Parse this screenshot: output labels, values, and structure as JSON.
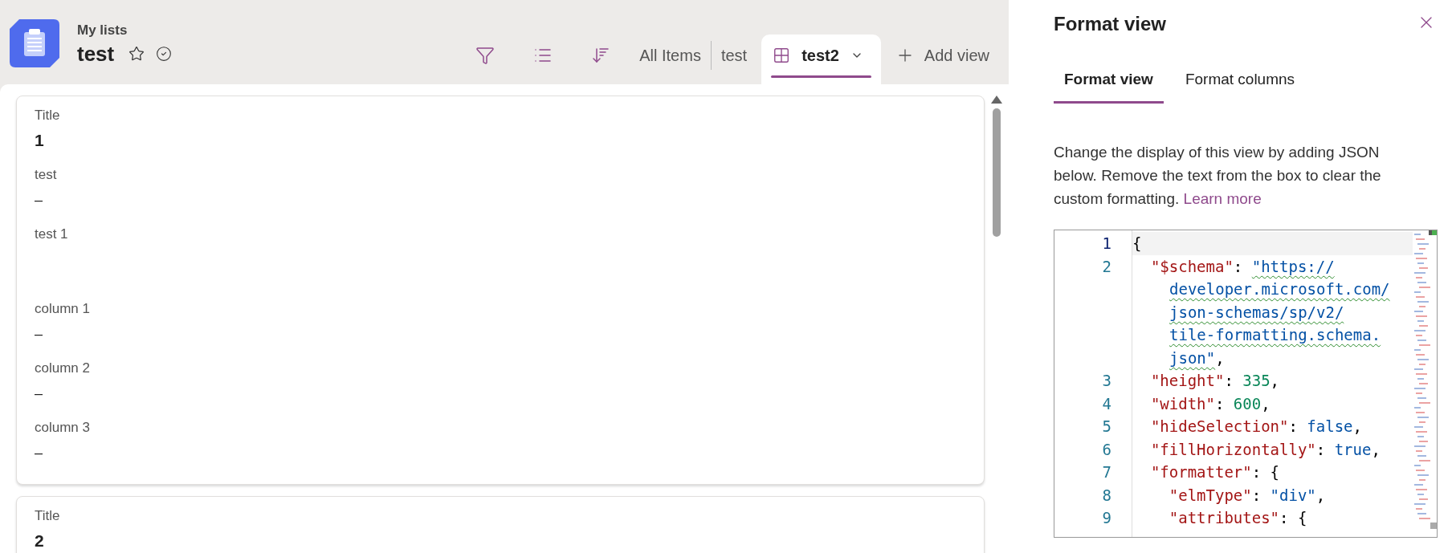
{
  "header": {
    "breadcrumb": "My lists",
    "title": "test",
    "favorite": false
  },
  "toolbar": {
    "views": [
      {
        "label": "All Items",
        "selected": false
      },
      {
        "label": "test",
        "selected": false
      },
      {
        "label": "test2",
        "selected": true
      }
    ],
    "add_view": "Add view"
  },
  "cards": [
    {
      "fields": [
        {
          "label": "Title",
          "value": "1",
          "kind": "title"
        },
        {
          "label": "test",
          "value": "–",
          "kind": "text"
        },
        {
          "label": "test 1",
          "kind": "multiline"
        },
        {
          "label": "column 1",
          "value": "–",
          "kind": "text"
        },
        {
          "label": "column 2",
          "value": "–",
          "kind": "text"
        },
        {
          "label": "column 3",
          "value": "–",
          "kind": "text"
        }
      ]
    },
    {
      "fields": [
        {
          "label": "Title",
          "value": "2",
          "kind": "title"
        }
      ]
    }
  ],
  "panel": {
    "title": "Format view",
    "tabs": [
      {
        "label": "Format view",
        "selected": true
      },
      {
        "label": "Format columns",
        "selected": false
      }
    ],
    "description": "Change the display of this view by adding JSON below. Remove the text from the box to clear the custom formatting.",
    "link": "Learn more",
    "code": {
      "lines": [
        {
          "number": "1",
          "current": true,
          "tokens": [
            {
              "kind": "punct",
              "text": "{"
            }
          ]
        },
        {
          "number": "2",
          "current": false,
          "tokens": [
            {
              "kind": "key",
              "text": "  \"$schema\""
            },
            {
              "kind": "punct",
              "text": ": "
            },
            {
              "kind": "link",
              "text": "\"https://"
            },
            {
              "kind": "link",
              "text": "developer.microsoft.com/",
              "wrap": true
            },
            {
              "kind": "link",
              "text": "json-schemas/sp/v2/",
              "wrap": true
            },
            {
              "kind": "link",
              "text": "tile-formatting.schema.",
              "wrap": true
            },
            {
              "kind": "link",
              "text": "json\"",
              "wrap": true
            },
            {
              "kind": "punct",
              "text": ","
            }
          ]
        },
        {
          "number": "3",
          "current": false,
          "tokens": [
            {
              "kind": "key",
              "text": "  \"height\""
            },
            {
              "kind": "punct",
              "text": ": "
            },
            {
              "kind": "number",
              "text": "335"
            },
            {
              "kind": "punct",
              "text": ","
            }
          ]
        },
        {
          "number": "4",
          "current": false,
          "tokens": [
            {
              "kind": "key",
              "text": "  \"width\""
            },
            {
              "kind": "punct",
              "text": ": "
            },
            {
              "kind": "number",
              "text": "600"
            },
            {
              "kind": "punct",
              "text": ","
            }
          ]
        },
        {
          "number": "5",
          "current": false,
          "tokens": [
            {
              "kind": "key",
              "text": "  \"hideSelection\""
            },
            {
              "kind": "punct",
              "text": ": "
            },
            {
              "kind": "keyword",
              "text": "false"
            },
            {
              "kind": "punct",
              "text": ","
            }
          ]
        },
        {
          "number": "6",
          "current": false,
          "tokens": [
            {
              "kind": "key",
              "text": "  \"fillHorizontally\""
            },
            {
              "kind": "punct",
              "text": ": "
            },
            {
              "kind": "keyword",
              "text": "true"
            },
            {
              "kind": "punct",
              "text": ","
            }
          ]
        },
        {
          "number": "7",
          "current": false,
          "tokens": [
            {
              "kind": "key",
              "text": "  \"formatter\""
            },
            {
              "kind": "punct",
              "text": ": {"
            }
          ]
        },
        {
          "number": "8",
          "current": false,
          "tokens": [
            {
              "kind": "key",
              "text": "    \"elmType\""
            },
            {
              "kind": "punct",
              "text": ": "
            },
            {
              "kind": "string",
              "text": "\"div\""
            },
            {
              "kind": "punct",
              "text": ","
            }
          ]
        },
        {
          "number": "9",
          "current": false,
          "tokens": [
            {
              "kind": "key",
              "text": "    \"attributes\""
            },
            {
              "kind": "punct",
              "text": ": {"
            }
          ]
        }
      ]
    }
  }
}
